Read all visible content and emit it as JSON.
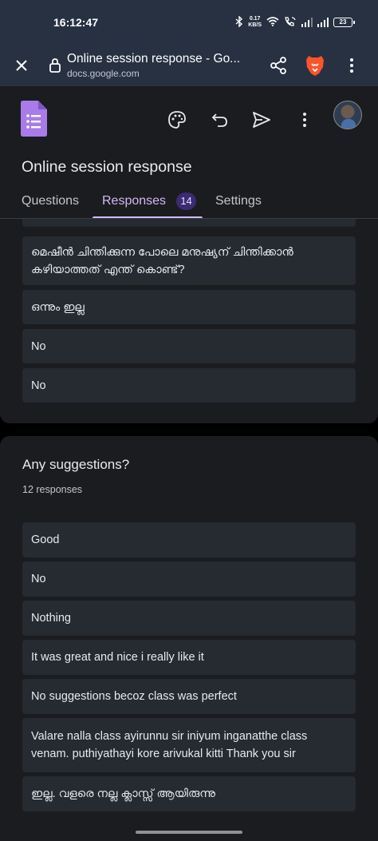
{
  "status_bar": {
    "time": "16:12:47",
    "net_speed_value": "0.17",
    "net_speed_unit": "KB/S",
    "battery": "23"
  },
  "browser": {
    "page_title": "Online session response - Go...",
    "domain": "docs.google.com",
    "icons": [
      "close-icon",
      "lock-icon",
      "share-icon",
      "brave-lion-icon",
      "more-vert-icon"
    ]
  },
  "form": {
    "title": "Online session response",
    "tabs": {
      "questions": "Questions",
      "responses": "Responses",
      "responses_count": "14",
      "settings": "Settings"
    },
    "toolbar_icons": [
      "palette-icon",
      "undo-icon",
      "send-icon",
      "more-vert-icon"
    ]
  },
  "previous_question": {
    "responses": [
      "മെഷീൻ ചിന്തിക്കുന്ന പോലെ മനുഷ്യന് ചിന്തിക്കാൻ കഴിയാത്തത് എന്ത് കൊണ്ട്?",
      "ഒന്നും ഇല്ല",
      "No",
      "No"
    ]
  },
  "suggestions_question": {
    "title": "Any suggestions?",
    "count": "12 responses",
    "responses": [
      "Good",
      "No",
      "Nothing",
      "It was great and nice i really like it",
      "No suggestions becoz class was perfect",
      "Valare nalla class ayirunnu sir iniyum inganatthe class venam. puthiyathayi kore arivukal kitti Thank you sir",
      "ഇല്ല. വളരെ നല്ല ക്ലാസ്സ് ആയിരുന്നു"
    ]
  },
  "colors": {
    "status_bar": "#273142",
    "surface": "#1a1c1f",
    "response_box": "#262a31",
    "accent": "#d4b8f5",
    "forms_logo": "#a97be8"
  }
}
